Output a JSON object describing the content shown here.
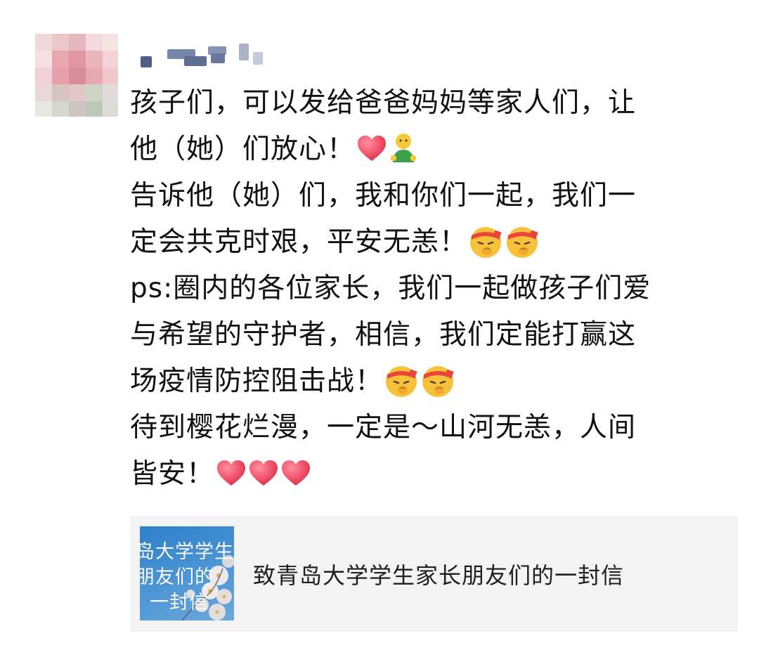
{
  "post": {
    "lines": [
      "孩子们，可以发给爸爸妈妈等家人们，让",
      "他（她）们放心！",
      "告诉他（她）们，我和你们一起，我们一",
      "定会共克时艰，平安无恙！",
      "ps:圈内的各位家长，我们一起做孩子们爱",
      "与希望的守护者，相信，我们定能打赢这",
      "场疫情防控阻击战！",
      "待到樱花烂漫，一定是～山河无恙，人间",
      "皆安！"
    ]
  },
  "link_card": {
    "title": "致青岛大学学生家长朋友们的一封信",
    "thumbnail_lines": [
      "岛大学学生",
      "朋友们的",
      "一封信"
    ]
  },
  "icons": {
    "avatar": "blurred-avatar",
    "username": "blurred-username",
    "heart": "red-heart-emoji",
    "person": "green-person-emoji",
    "face": "headband-face-emoji"
  },
  "colors": {
    "heart": "#f2566e",
    "person_shirt": "#3aa34a",
    "person_head": "#f6c935",
    "face": "#f6c23c",
    "headband": "#e9453c",
    "card_bg": "#f3f3f3",
    "thumb_blue": "#3f8ad0"
  }
}
